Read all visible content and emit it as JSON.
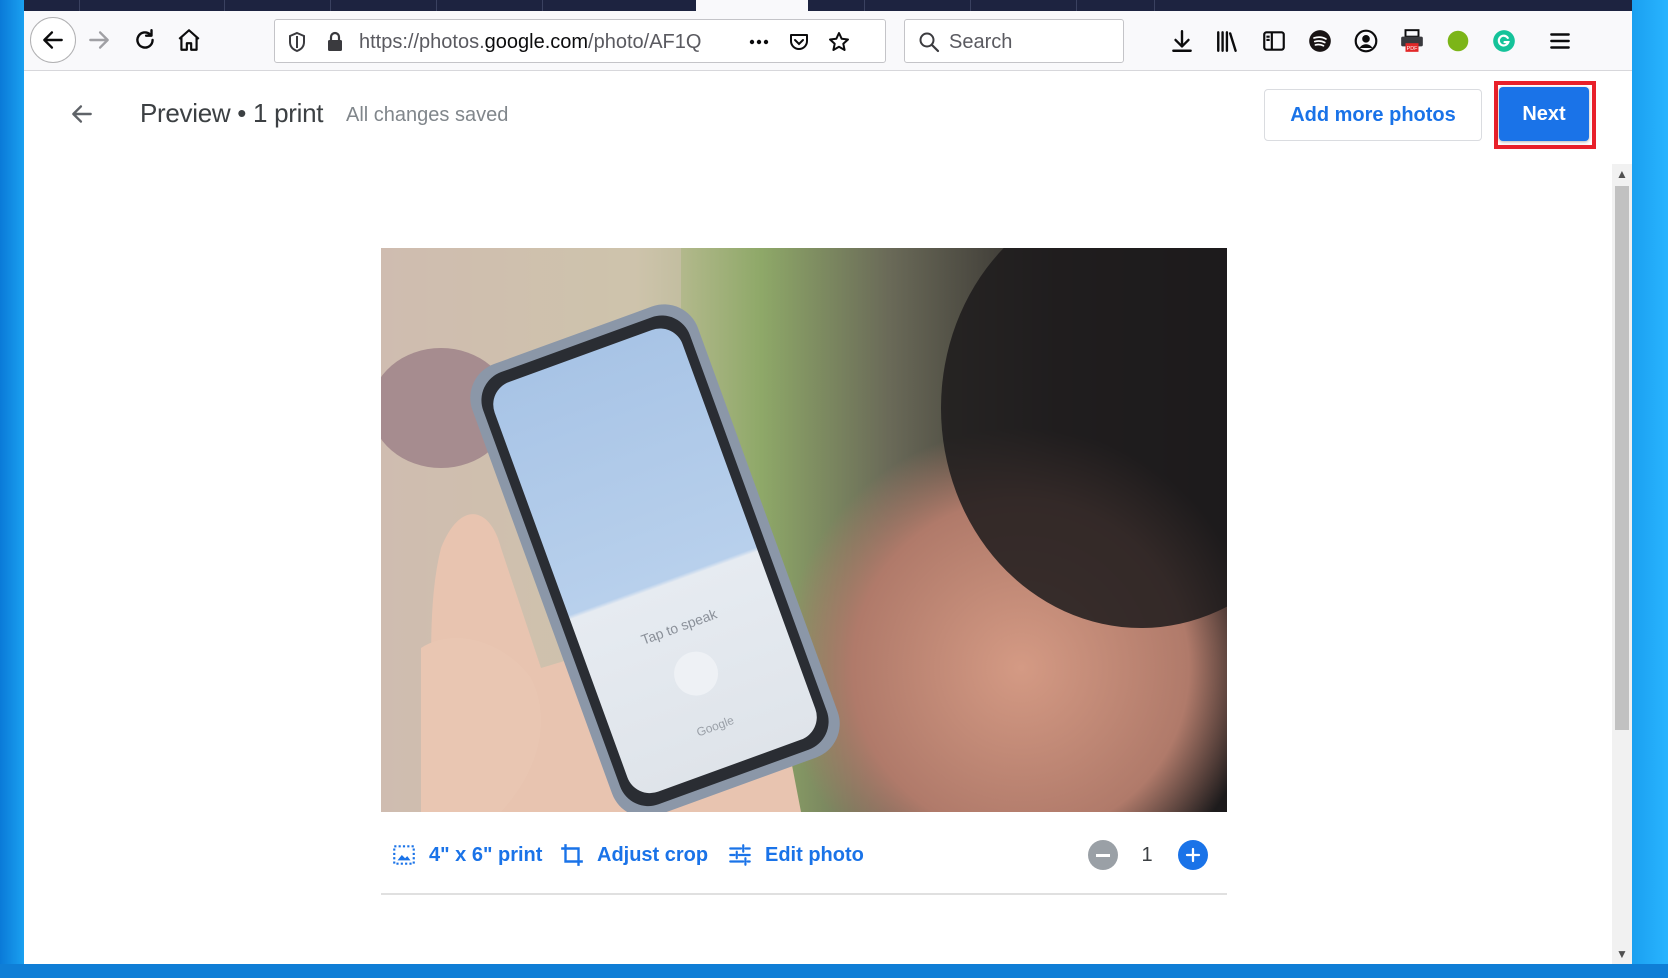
{
  "browser": {
    "url_prefix": "https://photos.",
    "url_host": "google.com",
    "url_suffix": "/photo/AF1Q",
    "search_placeholder": "Search",
    "icons": [
      "back-arrow-icon",
      "forward-arrow-icon",
      "reload-icon",
      "home-icon",
      "shield-icon",
      "lock-icon",
      "more-dots-icon",
      "pocket-icon",
      "star-icon",
      "search-icon",
      "download-icon",
      "library-icon",
      "reader-view-icon",
      "spotify-icon",
      "account-icon",
      "pdf-printer-icon",
      "green-dot-extension-icon",
      "grammarly-icon",
      "menu-icon"
    ]
  },
  "page": {
    "title": "Preview • 1 print",
    "save_status": "All changes saved",
    "add_more_label": "Add more photos",
    "next_label": "Next"
  },
  "controls": {
    "print_size_label": "4\" x 6\" print",
    "adjust_crop_label": "Adjust crop",
    "edit_photo_label": "Edit photo",
    "quantity": "1"
  },
  "photo": {
    "screen_texts": [
      "Tap to speak",
      "Google"
    ]
  },
  "colors": {
    "accent": "#1a73e8",
    "highlight": "#e8202a",
    "muted": "#80868b"
  }
}
